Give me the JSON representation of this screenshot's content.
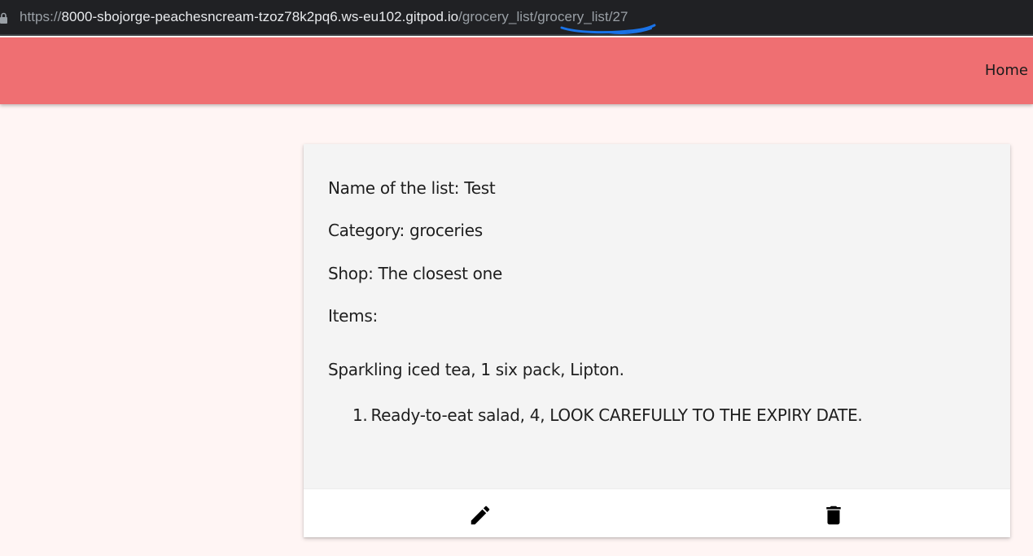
{
  "browser": {
    "url_scheme": "https://",
    "url_host": "8000-sbojorge-peachesncream-tzoz78k2pq6.ws-eu102.gitpod.io",
    "url_path": "/grocery_list/grocery_list/27"
  },
  "navbar": {
    "home_label": "Home"
  },
  "list_card": {
    "name_line": "Name of the list: Test",
    "category_line": "Category: groceries",
    "shop_line": "Shop: The closest one",
    "items_label": "Items:",
    "first_item": "Sparkling iced tea, 1 six pack, Lipton.",
    "numbered_items": [
      {
        "number": "1.",
        "text": "Ready-to-eat salad, 4, LOOK CAREFULLY TO THE EXPIRY DATE."
      }
    ],
    "actions": {
      "edit_icon": "pencil-icon",
      "delete_icon": "trash-icon"
    }
  },
  "colors": {
    "navbar": "#ef6f72",
    "page_background": "#fff5f4",
    "card_background": "#f4f4f4",
    "annotation_stroke": "#1a73e8"
  }
}
